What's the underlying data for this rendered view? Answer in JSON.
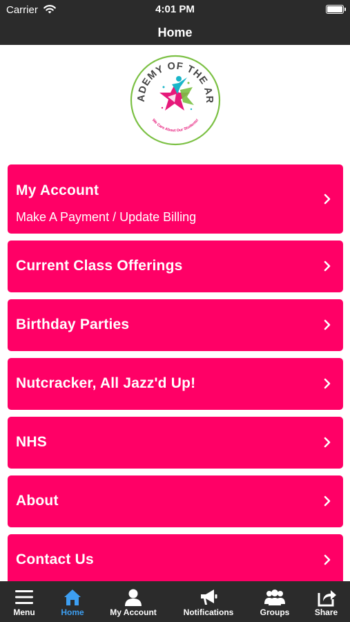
{
  "status_bar": {
    "carrier": "Carrier",
    "time": "4:01 PM"
  },
  "nav": {
    "title": "Home"
  },
  "logo": {
    "top_text": "ACADEMY OF THE ARTS",
    "bottom_text": "We Care About Our Students!",
    "colors": {
      "ring": "#7bc043",
      "text": "#444444",
      "star_pink": "#e6197a",
      "star_teal": "#1ab6c9",
      "star_green": "#7bc043"
    }
  },
  "menu": {
    "items": [
      {
        "title": "My Account",
        "subtitle": "Make A Payment / Update Billing"
      },
      {
        "title": "Current Class Offerings"
      },
      {
        "title": "Birthday Parties"
      },
      {
        "title": "Nutcracker, All Jazz'd Up!"
      },
      {
        "title": "NHS"
      },
      {
        "title": "About"
      },
      {
        "title": "Contact Us"
      }
    ]
  },
  "tabs": [
    {
      "label": "Menu",
      "icon": "menu-icon"
    },
    {
      "label": "Home",
      "icon": "home-icon",
      "active": true
    },
    {
      "label": "My Account",
      "icon": "user-icon"
    },
    {
      "label": "Notifications",
      "icon": "megaphone-icon"
    },
    {
      "label": "Groups",
      "icon": "group-icon"
    },
    {
      "label": "Share",
      "icon": "share-icon"
    }
  ],
  "colors": {
    "bar_bg": "#2b2b2b",
    "tile_bg": "#ff0066",
    "active_tab": "#3d9ff2"
  }
}
